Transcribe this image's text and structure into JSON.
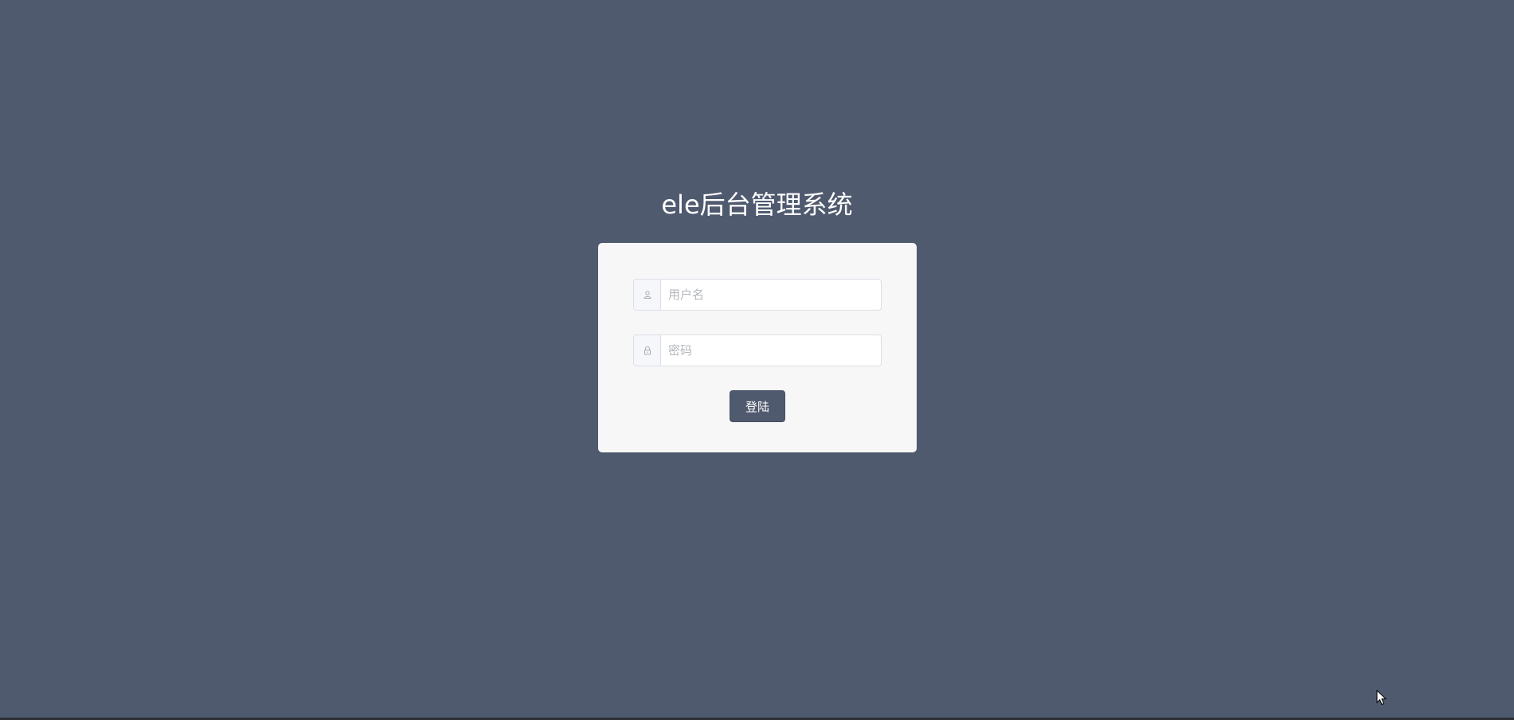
{
  "login": {
    "title": "ele后台管理系统",
    "username": {
      "placeholder": "用户名",
      "value": "",
      "icon": "user-icon"
    },
    "password": {
      "placeholder": "密码",
      "value": "",
      "icon": "lock-icon"
    },
    "submit_label": "登陆"
  },
  "colors": {
    "background": "#505a6f",
    "card": "#f7f7f7",
    "button": "#505a6f",
    "icon": "#a8abb2"
  }
}
